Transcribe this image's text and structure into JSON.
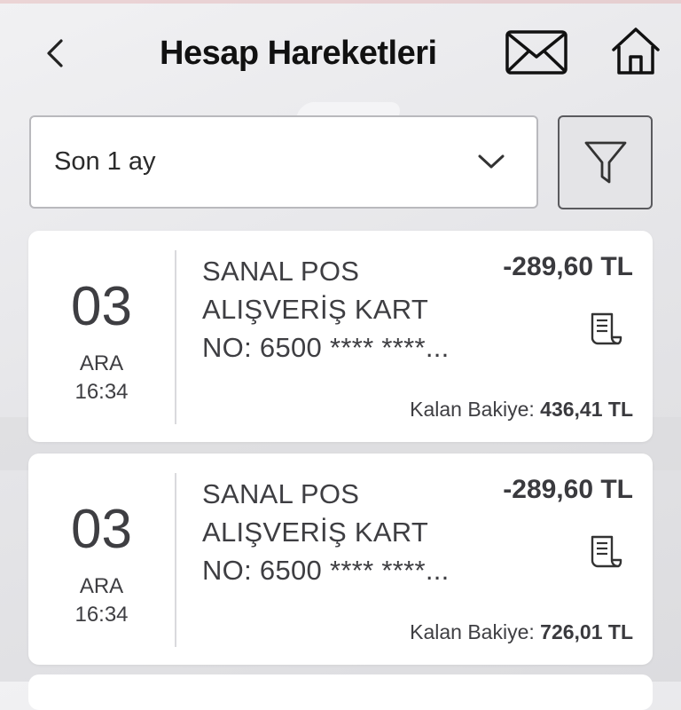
{
  "header": {
    "title": "Hesap Hareketleri",
    "icons": {
      "back": "chevron-left-icon",
      "mail": "envelope-icon",
      "home": "home-icon"
    }
  },
  "period_select": {
    "value": "Son 1 ay",
    "icon": "chevron-down-icon"
  },
  "filter": {
    "icon": "filter-funnel-icon"
  },
  "balance_label": "Kalan Bakiye:",
  "transactions": [
    {
      "day": "03",
      "month": "ARA",
      "time": "16:34",
      "description": "SANAL POS ALIŞVERİŞ KART NO: 6500 **** ****...",
      "amount": "-289,60 TL",
      "balance": "436,41 TL",
      "icon": "receipt-icon"
    },
    {
      "day": "03",
      "month": "ARA",
      "time": "16:34",
      "description": "SANAL POS ALIŞVERİŞ KART NO: 6500 **** ****...",
      "amount": "-289,60 TL",
      "balance": "726,01 TL",
      "icon": "receipt-icon"
    }
  ]
}
